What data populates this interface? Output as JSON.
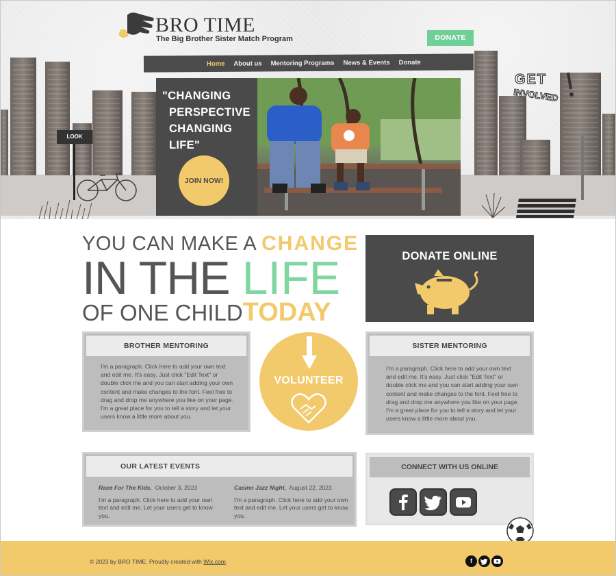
{
  "brand": {
    "title": "BRO TIME",
    "subtitle": "The Big Brother Sister Match Program",
    "donate_button": "DONATE"
  },
  "nav": {
    "items": [
      {
        "label": "Home",
        "active": true
      },
      {
        "label": "About us",
        "active": false
      },
      {
        "label": "Mentoring Programs",
        "active": false
      },
      {
        "label": "News & Events",
        "active": false
      },
      {
        "label": "Donate",
        "active": false
      }
    ]
  },
  "hero": {
    "quote_line1": "\"CHANGING",
    "quote_line2": "PERSPECTIVE",
    "quote_line3": "CHANGING",
    "quote_line4": "LIFE\"",
    "join_button": "JOIN NOW!",
    "sign_text": "LOOK",
    "get_involved": "GET INVOLVED!"
  },
  "headline": {
    "line1_prefix": "YOU CAN MAKE A ",
    "line1_accent": "CHANGE",
    "line2_prefix": "IN THE ",
    "line2_accent": "LIFE",
    "line3_prefix": "OF ONE CHILD",
    "line3_accent": "TODAY"
  },
  "donate_online": {
    "title": "DONATE ONLINE"
  },
  "brother": {
    "title": "BROTHER MENTORING",
    "body": "I'm a paragraph. Click here to add your own text and edit me. It's easy. Just click \"Edit Text\" or double click me and you can start adding your own content and make changes to the font. Feel free to drag and drop me anywhere you like on your page. I'm a great place for you to tell a story and let your users know a little more about you."
  },
  "sister": {
    "title": "SISTER MENTORING",
    "body": "I'm a paragraph. Click here to add your own text and edit me. It's easy. Just click \"Edit Text\" or double click me and you can start adding your own content and make changes to the font. Feel free to drag and drop me anywhere you like on your page. I'm a great place for you to tell a story and let your users know a little more about you."
  },
  "volunteer": {
    "label": "VOLUNTEER"
  },
  "events": {
    "title": "OUR LATEST EVENTS",
    "items": [
      {
        "name": "Race For The Kids,",
        "date": "October 3, 2023",
        "body": "I'm a paragraph. Click here to add your own text and edit me. Let your users get to know you."
      },
      {
        "name": "Casino Jazz Night,",
        "date": "August 22, 2023",
        "body": "I'm a paragraph. Click here to add your own text and edit me. Let your users get to know you."
      }
    ]
  },
  "connect": {
    "title": "CONNECT WITH US ONLINE",
    "icons": [
      "facebook-icon",
      "twitter-icon",
      "youtube-icon"
    ]
  },
  "footer": {
    "text": "© 2023 by BRO TIME. Proudly created with ",
    "link": "Wix.com"
  },
  "colors": {
    "yellow": "#f2c96b",
    "green": "#6fcf97",
    "dark": "#4a4a4a",
    "gray": "#bdbdbd"
  }
}
